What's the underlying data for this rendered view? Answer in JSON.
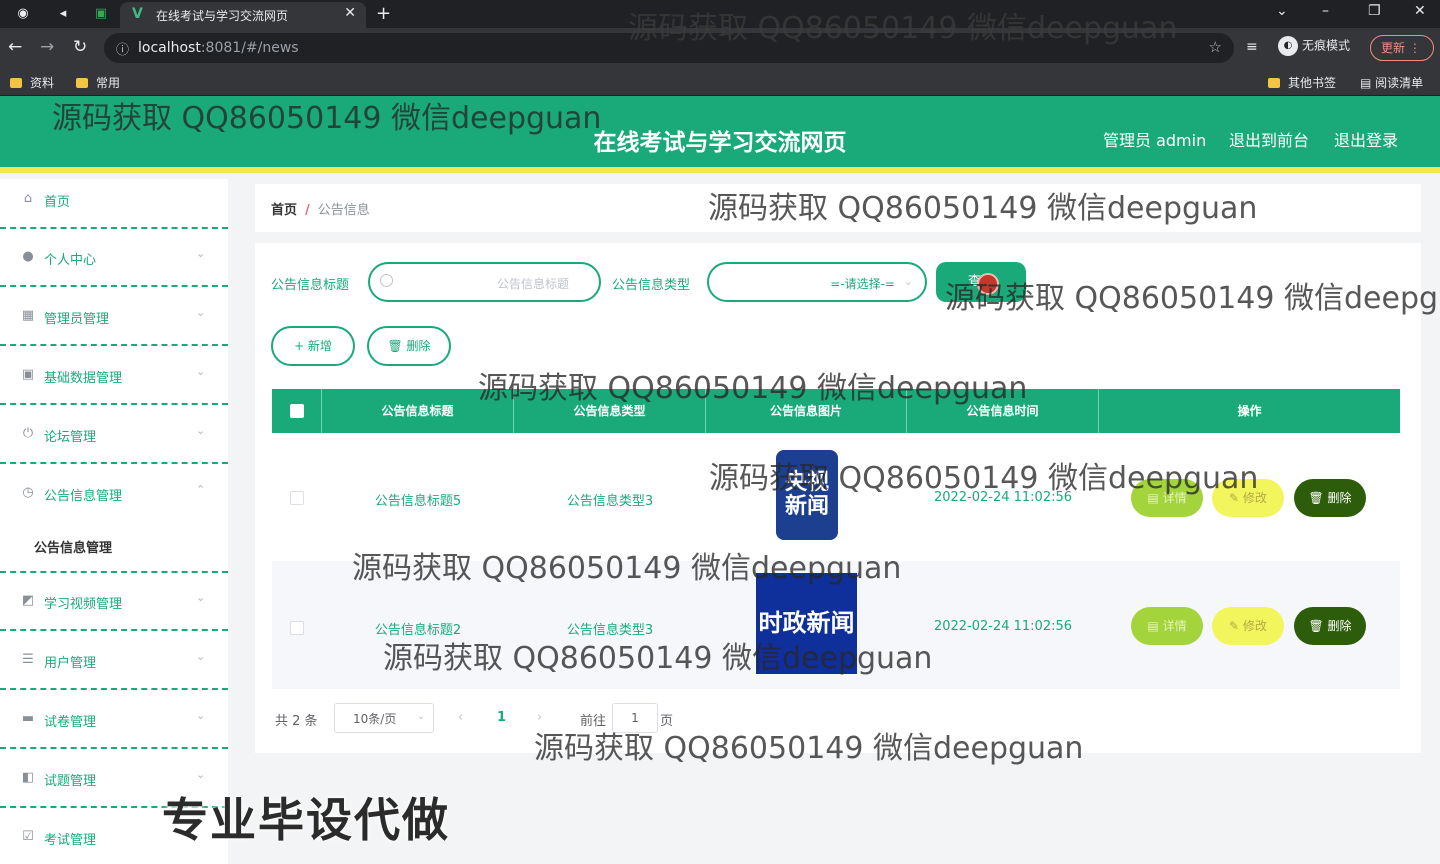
{
  "browser": {
    "tab_title": "在线考试与学习交流网页",
    "url_host": "localhost",
    "url_rest": ":8081/#/news",
    "incognito_label": "无痕模式",
    "update_label": "更新",
    "bookmarks": [
      "资料",
      "常用"
    ],
    "bookmarks_right": [
      "其他书签",
      "阅读清单"
    ]
  },
  "header": {
    "title": "在线考试与学习交流网页",
    "admin": "管理员 admin",
    "to_front": "退出到前台",
    "logout": "退出登录",
    "accent_color": "#1aaa7a",
    "stripe_color": "#f3e84a"
  },
  "sidebar": {
    "items": [
      {
        "label": "首页",
        "icon": "home-icon"
      },
      {
        "label": "个人中心",
        "icon": "user-icon"
      },
      {
        "label": "管理员管理",
        "icon": "grid-icon"
      },
      {
        "label": "基础数据管理",
        "icon": "clipboard-icon"
      },
      {
        "label": "论坛管理",
        "icon": "power-icon"
      },
      {
        "label": "公告信息管理",
        "icon": "clock-icon"
      },
      {
        "label": "学习视频管理",
        "icon": "chart-icon"
      },
      {
        "label": "用户管理",
        "icon": "list-icon"
      },
      {
        "label": "试卷管理",
        "icon": "chat-icon"
      },
      {
        "label": "试题管理",
        "icon": "wallet-icon"
      },
      {
        "label": "考试管理",
        "icon": "check-icon"
      }
    ],
    "submenu_active": "公告信息管理"
  },
  "breadcrumb": {
    "home": "首页",
    "sep": "/",
    "current": "公告信息"
  },
  "filters": {
    "title_label": "公告信息标题",
    "title_placeholder": "公告信息标题",
    "type_label": "公告信息类型",
    "type_value": "=-请选择-=",
    "query_button": "查询"
  },
  "actions": {
    "add": "+ 新增",
    "delete": "删除"
  },
  "table": {
    "headers": [
      "公告信息标题",
      "公告信息类型",
      "公告信息图片",
      "公告信息时间",
      "操作"
    ],
    "rows": [
      {
        "title": "公告信息标题5",
        "type": "公告信息类型3",
        "image_text": "央视新闻",
        "time": "2022-02-24 11:02:56"
      },
      {
        "title": "公告信息标题2",
        "type": "公告信息类型3",
        "image_text": "时政新闻",
        "time": "2022-02-24 11:02:56"
      }
    ],
    "btn_detail": "详情",
    "btn_edit": "修改",
    "btn_delete": "删除"
  },
  "pagination": {
    "total": "共 2 条",
    "page_size": "10条/页",
    "current_page": "1",
    "goto_prefix": "前往",
    "goto_value": "1",
    "goto_suffix": "页"
  },
  "overlays": {
    "watermark": "源码获取 QQ86050149 微信deepguan",
    "promo": "专业毕设代做"
  }
}
